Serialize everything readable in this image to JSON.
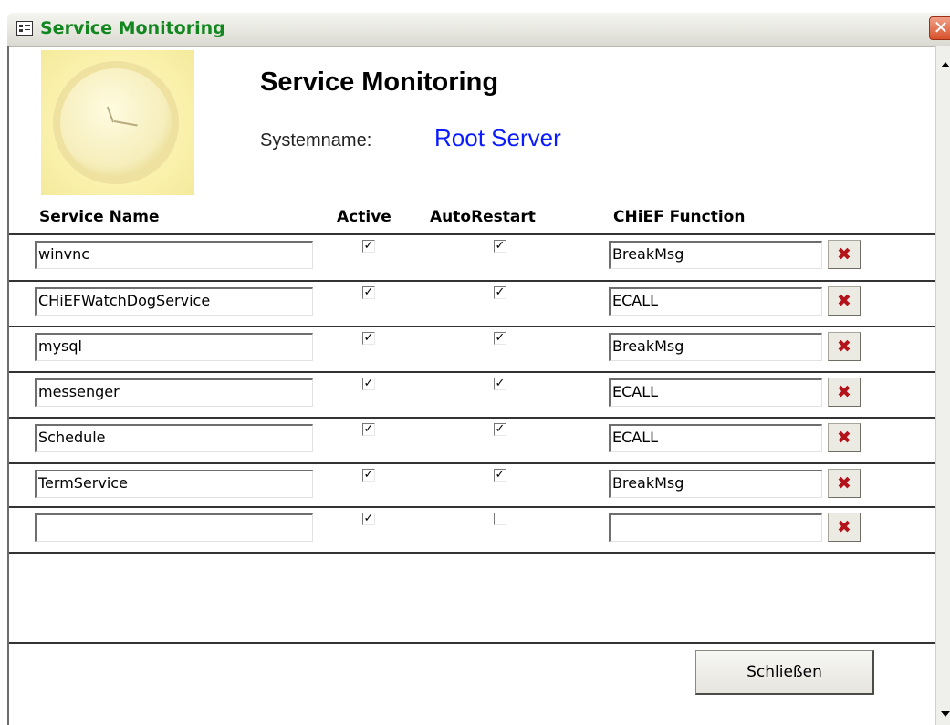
{
  "window": {
    "title": "Service Monitoring",
    "close_glyph": "✕"
  },
  "header": {
    "heading": "Service Monitoring",
    "system_label": "Systemname:",
    "system_value": "Root Server"
  },
  "columns": {
    "service_name": "Service Name",
    "active": "Active",
    "auto_restart": "AutoRestart",
    "chief_function": "CHiEF Function"
  },
  "rows": [
    {
      "service": "winvnc",
      "active": "✓",
      "auto_restart": "✓",
      "function": "BreakMsg"
    },
    {
      "service": "CHiEFWatchDogService",
      "active": "✓",
      "auto_restart": "✓",
      "function": "ECALL"
    },
    {
      "service": "mysql",
      "active": "✓",
      "auto_restart": "✓",
      "function": "BreakMsg"
    },
    {
      "service": "messenger",
      "active": "✓",
      "auto_restart": "✓",
      "function": "ECALL"
    },
    {
      "service": "Schedule",
      "active": "✓",
      "auto_restart": "✓",
      "function": "ECALL"
    },
    {
      "service": "TermService",
      "active": "✓",
      "auto_restart": "✓",
      "function": "BreakMsg"
    },
    {
      "service": "",
      "active": "✓",
      "auto_restart": "",
      "function": ""
    }
  ],
  "delete_glyph": "✖",
  "footer": {
    "close_button": "Schließen"
  },
  "icons": {
    "window": "form-icon",
    "delete": "delete-record-icon",
    "clock": "clock-image"
  },
  "colors": {
    "title_text": "#13871f",
    "system_value": "#0a1bff",
    "delete_icon": "#b3141b"
  }
}
